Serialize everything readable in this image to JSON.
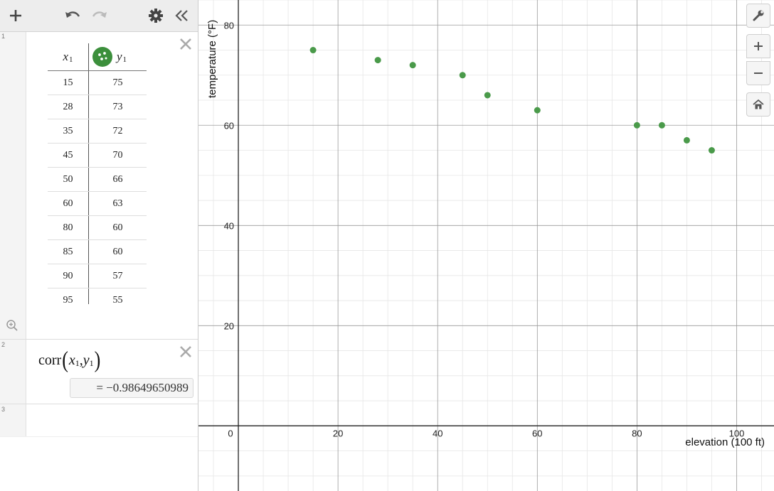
{
  "toolbar": {
    "add_icon": "plus-icon",
    "undo_icon": "undo-icon",
    "redo_icon": "redo-icon",
    "settings_icon": "gear-icon",
    "collapse_icon": "double-chevron-left-icon"
  },
  "expressions": {
    "numbers": [
      "1",
      "2",
      "3"
    ],
    "table": {
      "col1_var": "x",
      "col1_sub": "1",
      "col2_var": "y",
      "col2_sub": "1",
      "series_color": "#3c8f3c",
      "rows": [
        {
          "x": "15",
          "y": "75"
        },
        {
          "x": "28",
          "y": "73"
        },
        {
          "x": "35",
          "y": "72"
        },
        {
          "x": "45",
          "y": "70"
        },
        {
          "x": "50",
          "y": "66"
        },
        {
          "x": "60",
          "y": "63"
        },
        {
          "x": "80",
          "y": "60"
        },
        {
          "x": "85",
          "y": "60"
        },
        {
          "x": "90",
          "y": "57"
        },
        {
          "x": "95",
          "y": "55"
        }
      ]
    },
    "corr": {
      "func": "corr",
      "arg1": "x",
      "arg1_sub": "1",
      "comma": ",",
      "arg2": "y",
      "arg2_sub": "1",
      "result": "=  −0.98649650989"
    }
  },
  "graph_controls": {
    "settings_icon": "wrench-icon",
    "zoom_in_icon": "zoom-in-icon",
    "zoom_out_icon": "zoom-out-icon",
    "home_icon": "home-icon"
  },
  "chart_data": {
    "type": "scatter",
    "xlabel": "elevation (100 ft)",
    "ylabel": "temperature (°F)",
    "xlim": [
      -8,
      107.5
    ],
    "ylim": [
      -13,
      85
    ],
    "x_ticks": [
      "0",
      "20",
      "40",
      "60",
      "80",
      "100"
    ],
    "y_ticks": [
      "20",
      "40",
      "60",
      "80"
    ],
    "grid": true,
    "minor_grid": true,
    "point_color": "#4a9a4a",
    "series": [
      {
        "x": [
          15,
          28,
          35,
          45,
          50,
          60,
          80,
          85,
          90,
          95
        ],
        "y": [
          75,
          73,
          72,
          70,
          66,
          63,
          60,
          60,
          57,
          55
        ]
      }
    ]
  }
}
